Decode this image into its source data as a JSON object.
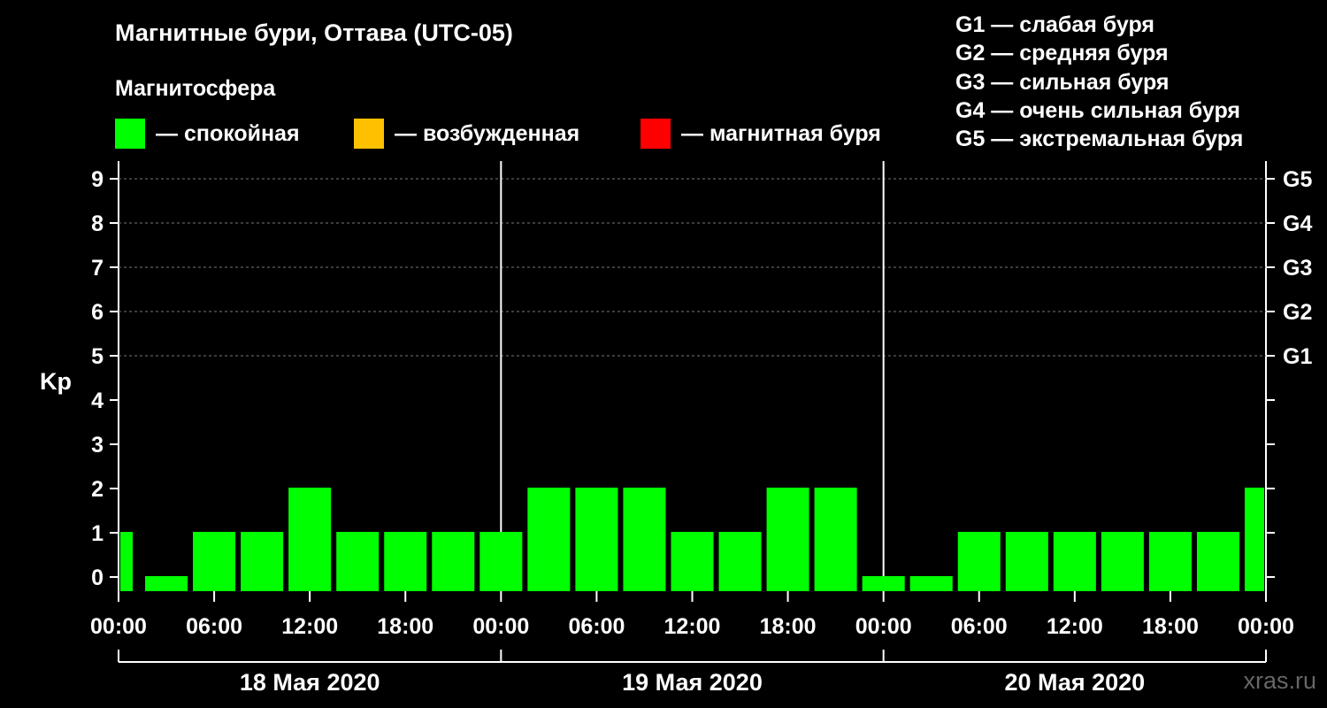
{
  "title": "Магнитные бури, Оттава (UTC-05)",
  "magnetosphere": {
    "title": "Магнитосфера",
    "legend": [
      {
        "label": "— спокойная",
        "color": "#00ff00"
      },
      {
        "label": "— возбужденная",
        "color": "#ffc000"
      },
      {
        "label": "— магнитная буря",
        "color": "#ff0000"
      }
    ]
  },
  "g_scale": [
    "G1 — слабая буря",
    "G2 — средняя буря",
    "G3 — сильная буря",
    "G4 — очень сильная буря",
    "G5 — экстремальная буря"
  ],
  "watermark": "xras.ru",
  "chart_data": {
    "type": "bar",
    "ylabel": "Kp",
    "ylim": [
      0,
      9
    ],
    "y_ticks": [
      0,
      1,
      2,
      3,
      4,
      5,
      6,
      7,
      8,
      9
    ],
    "right_axis_labels": [
      {
        "value": 5,
        "label": "G1"
      },
      {
        "value": 6,
        "label": "G2"
      },
      {
        "value": 7,
        "label": "G3"
      },
      {
        "value": 8,
        "label": "G4"
      },
      {
        "value": 9,
        "label": "G5"
      }
    ],
    "x_tick_labels": [
      "00:00",
      "06:00",
      "12:00",
      "18:00",
      "00:00",
      "06:00",
      "12:00",
      "18:00",
      "00:00",
      "06:00",
      "12:00",
      "18:00",
      "00:00"
    ],
    "days": [
      "18 Мая 2020",
      "19 Мая 2020",
      "20 Мая 2020"
    ],
    "bar_interval_hours": 3,
    "values": [
      1,
      0,
      1,
      1,
      2,
      1,
      1,
      1,
      1,
      2,
      2,
      2,
      1,
      1,
      2,
      2,
      0,
      0,
      1,
      1,
      1,
      1,
      1,
      1,
      2
    ],
    "first_bar_partial": true,
    "bar_color": "#00ff00",
    "grid": "dashed horizontal at Kp 5–9",
    "legend_position": "top"
  }
}
